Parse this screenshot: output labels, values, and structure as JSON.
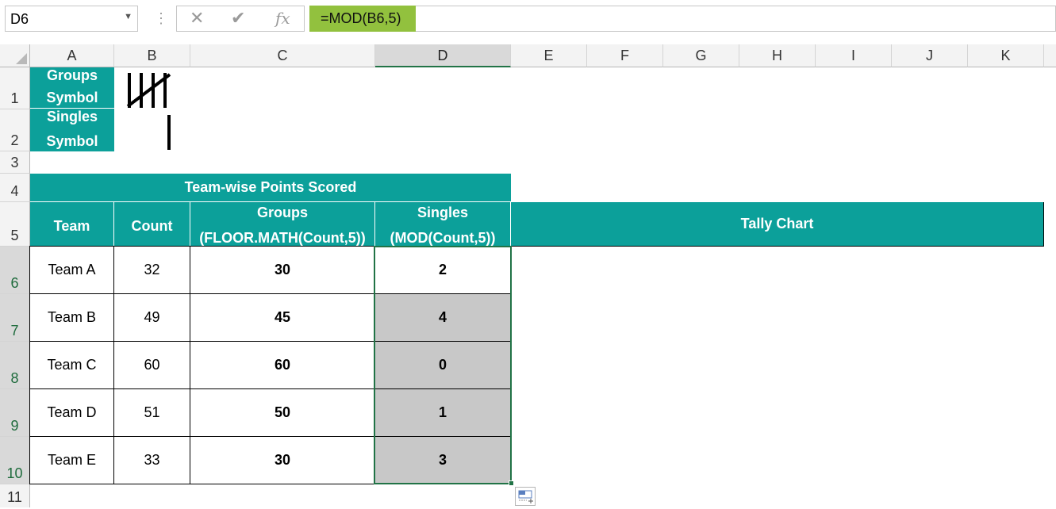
{
  "formula_bar": {
    "name_box": "D6",
    "separator": "⋮",
    "cancel_icon": "✕",
    "enter_icon": "✔",
    "fx_label": "fx",
    "formula": "=MOD(B6,5)"
  },
  "columns": [
    "A",
    "B",
    "C",
    "D",
    "E",
    "F",
    "G",
    "H",
    "I",
    "J",
    "K"
  ],
  "rows": [
    "1",
    "2",
    "3",
    "4",
    "5",
    "6",
    "7",
    "8",
    "9",
    "10",
    "11"
  ],
  "legend": {
    "groups": {
      "line1": "Groups",
      "line2": "Symbol"
    },
    "singles": {
      "line1": "Singles",
      "line2": "Symbol"
    }
  },
  "table": {
    "title": "Team-wise Points Scored",
    "headers": {
      "team": "Team",
      "count": "Count",
      "groups_line1": "Groups",
      "groups_line2": "(FLOOR.MATH(Count,5))",
      "singles_line1": "Singles",
      "singles_line2": "(MOD(Count,5))",
      "tally": "Tally Chart"
    },
    "rows": [
      {
        "team": "Team A",
        "count": "32",
        "groups": "30",
        "singles": "2"
      },
      {
        "team": "Team B",
        "count": "49",
        "groups": "45",
        "singles": "4"
      },
      {
        "team": "Team C",
        "count": "60",
        "groups": "60",
        "singles": "0"
      },
      {
        "team": "Team D",
        "count": "51",
        "groups": "50",
        "singles": "1"
      },
      {
        "team": "Team E",
        "count": "33",
        "groups": "30",
        "singles": "3"
      }
    ]
  },
  "colors": {
    "teal": "#0ca09a",
    "selection": "#217346",
    "formula_highlight": "#92c13e"
  }
}
